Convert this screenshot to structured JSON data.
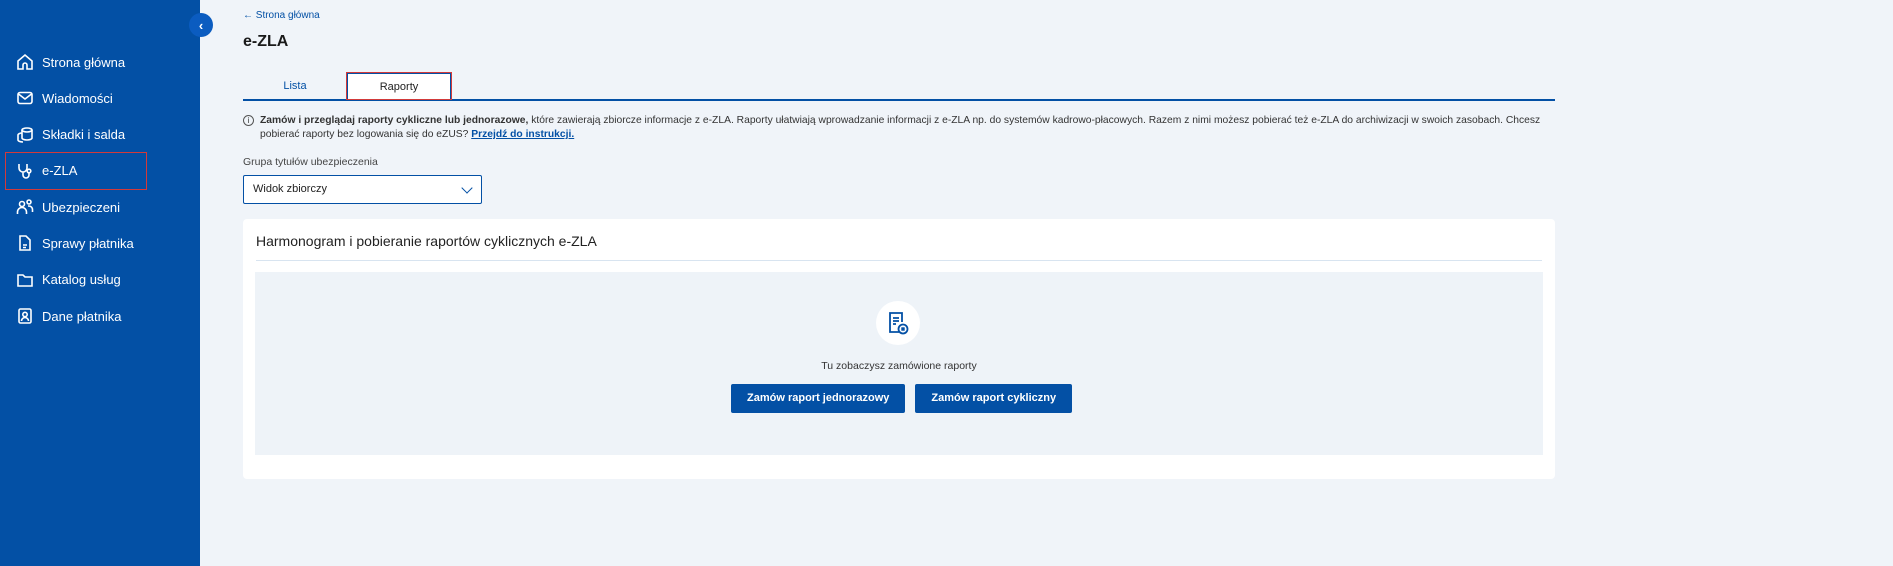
{
  "sidebar": {
    "items": [
      {
        "label": "Strona główna",
        "icon": "home-icon"
      },
      {
        "label": "Wiadomości",
        "icon": "mail-icon"
      },
      {
        "label": "Składki i salda",
        "icon": "coins-icon"
      },
      {
        "label": "e-ZLA",
        "icon": "stethoscope-icon",
        "active": true
      },
      {
        "label": "Ubezpieczeni",
        "icon": "users-icon"
      },
      {
        "label": "Sprawy płatnika",
        "icon": "document-icon"
      },
      {
        "label": "Katalog usług",
        "icon": "folder-icon"
      },
      {
        "label": "Dane płatnika",
        "icon": "id-card-icon"
      }
    ]
  },
  "header": {
    "back": "← Strona główna",
    "title": "e-ZLA"
  },
  "tabs": [
    {
      "label": "Lista"
    },
    {
      "label": "Raporty",
      "active": true
    }
  ],
  "info": {
    "bold": "Zamów i przeglądaj raporty cykliczne lub jednorazowe,",
    "text": " które zawierają zbiorcze informacje z e-ZLA. Raporty ułatwiają wprowadzanie informacji z e-ZLA np. do systemów kadrowo-płacowych. Razem z nimi możesz pobierać też e-ZLA do archiwizacji w swoich zasobach. Chcesz pobierać raporty bez logowania się do eZUS? ",
    "link": "Przejdź do instrukcji."
  },
  "filter": {
    "label": "Grupa tytułów ubezpieczenia",
    "value": "Widok zbiorczy"
  },
  "card": {
    "title": "Harmonogram i pobieranie raportów cyklicznych e-ZLA",
    "empty_text": "Tu zobaczysz zamówione raporty",
    "btn_once": "Zamów raport jednorazowy",
    "btn_cyclic": "Zamów raport cykliczny"
  }
}
